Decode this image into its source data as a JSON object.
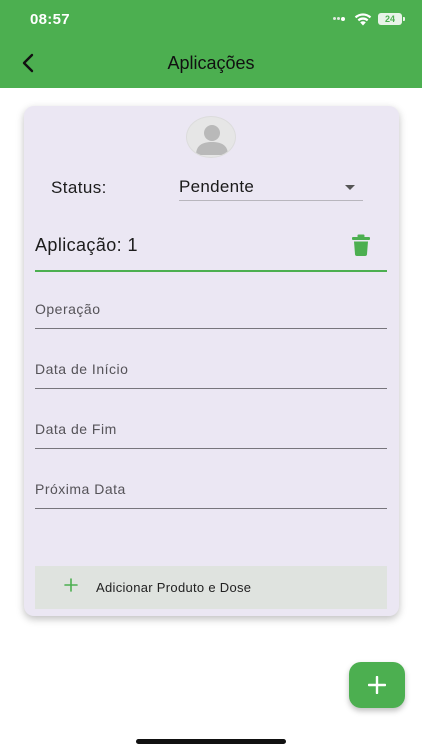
{
  "status_bar": {
    "time": "08:57",
    "battery": "24"
  },
  "header": {
    "title": "Aplicações",
    "back_icon": "chevron-left-icon"
  },
  "card": {
    "avatar_icon": "person-avatar-icon",
    "status_label": "Status:",
    "status_value": "Pendente",
    "application_title": "Aplicação: 1",
    "delete_icon": "trash-icon",
    "fields": [
      {
        "placeholder": "Operação"
      },
      {
        "placeholder": "Data de Início"
      },
      {
        "placeholder": "Data de Fim"
      },
      {
        "placeholder": "Próxima Data"
      }
    ],
    "add_product_label": "Adicionar Produto e Dose"
  },
  "fab_icon": "plus-icon",
  "colors": {
    "primary": "#4caf50",
    "card_background": "#ebe7f3",
    "add_button_background": "#dfe3df"
  }
}
